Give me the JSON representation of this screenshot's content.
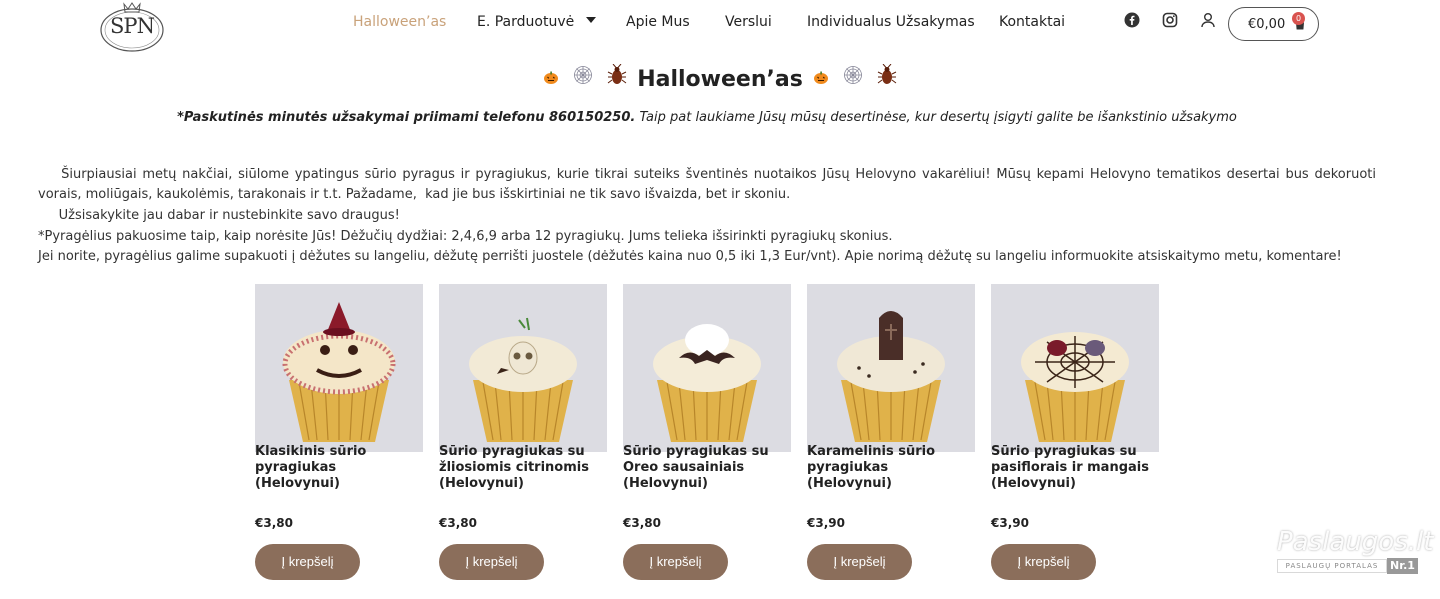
{
  "header": {
    "logo_text": "SPN",
    "nav": [
      {
        "label": "Halloween’as",
        "active": true
      },
      {
        "label": "E. Parduotuvė",
        "active": false,
        "has_dropdown": true
      },
      {
        "label": "Apie Mus",
        "active": false
      },
      {
        "label": "Verslui",
        "active": false
      },
      {
        "label": "Individualus Užsakymas",
        "active": false
      },
      {
        "label": "Kontaktai",
        "active": false
      }
    ],
    "icons": [
      "facebook-icon",
      "instagram-icon",
      "user-icon"
    ],
    "cart": {
      "total": "€0,00",
      "count": "0"
    }
  },
  "title": {
    "text": "Halloween’as",
    "emojis_left": [
      "🎃",
      "🕸",
      "🪳"
    ],
    "emojis_right": [
      "🎃",
      "🕸",
      "🪳"
    ]
  },
  "notice": {
    "bold": "*Paskutinės minutės užsakymai priimami telefonu 860150250.",
    "rest": " Taip pat laukiame Jūsų mūsų desertinėse, kur desertų įsigyti galite be išankstinio užsakymo"
  },
  "description": {
    "p1": "    Šiurpiausiai metų nakčiai, siūlome ypatingus sūrio pyragus ir pyragiukus, kurie tikrai suteiks šventinės nuotaikos Jūsų Helovyno vakarėliui! Mūsų kepami Helovyno tematikos desertai bus dekoruoti vorais, moliūgais, kaukolėmis, tarakonais ir t.t. Pažadame,  kad jie bus išskirtiniai ne tik savo išvaizda, bet ir skoniu.",
    "p2": "     Užsisakykite jau dabar ir nustebinkite savo draugus!",
    "p3": "*Pyragėlius pakuosime taip, kaip norėsite Jūs! Dėžučių dydžiai: 2,4,6,9 arba 12 pyragiukų. Jums telieka išsirinkti pyragiukų skonius.",
    "p4": "Jei norite, pyragėlius galime supakuoti į dėžutes su langeliu, dėžutę perrišti juostele (dėžutės kaina nuo 0,5 iki 1,3 Eur/vnt). Apie norimą dėžutę su langeliu informuokite atsiskaitymo metu, komentare!"
  },
  "products": [
    {
      "name": "Klasikinis sūrio pyragiukas (Helovynui)",
      "price": "€3,80",
      "button": "Į krepšelį",
      "decoration": "jack-o-lantern-face"
    },
    {
      "name": "Sūrio pyragiukas su žliosiomis citrinomis (Helovynui)",
      "price": "€3,80",
      "button": "Į krepšelį",
      "decoration": "skull"
    },
    {
      "name": "Sūrio pyragiukas su Oreo sausainiais (Helovynui)",
      "price": "€3,80",
      "button": "Į krepšelį",
      "decoration": "bat"
    },
    {
      "name": "Karamelinis sūrio pyragiukas (Helovynui)",
      "price": "€3,90",
      "button": "Į krepšelį",
      "decoration": "tombstone"
    },
    {
      "name": "Sūrio pyragiukas su pasiflorais ir mangais (Helovynui)",
      "price": "€3,90",
      "button": "Į krepšelį",
      "decoration": "spider-web"
    }
  ],
  "watermark": {
    "main": "Paslaugos.lt",
    "sub": "PASLAUGŲ PORTALAS",
    "badge": "Nr.1"
  },
  "colors": {
    "accent": "#c9a27a",
    "button": "#8b6e5b",
    "badge": "#d9534f"
  }
}
